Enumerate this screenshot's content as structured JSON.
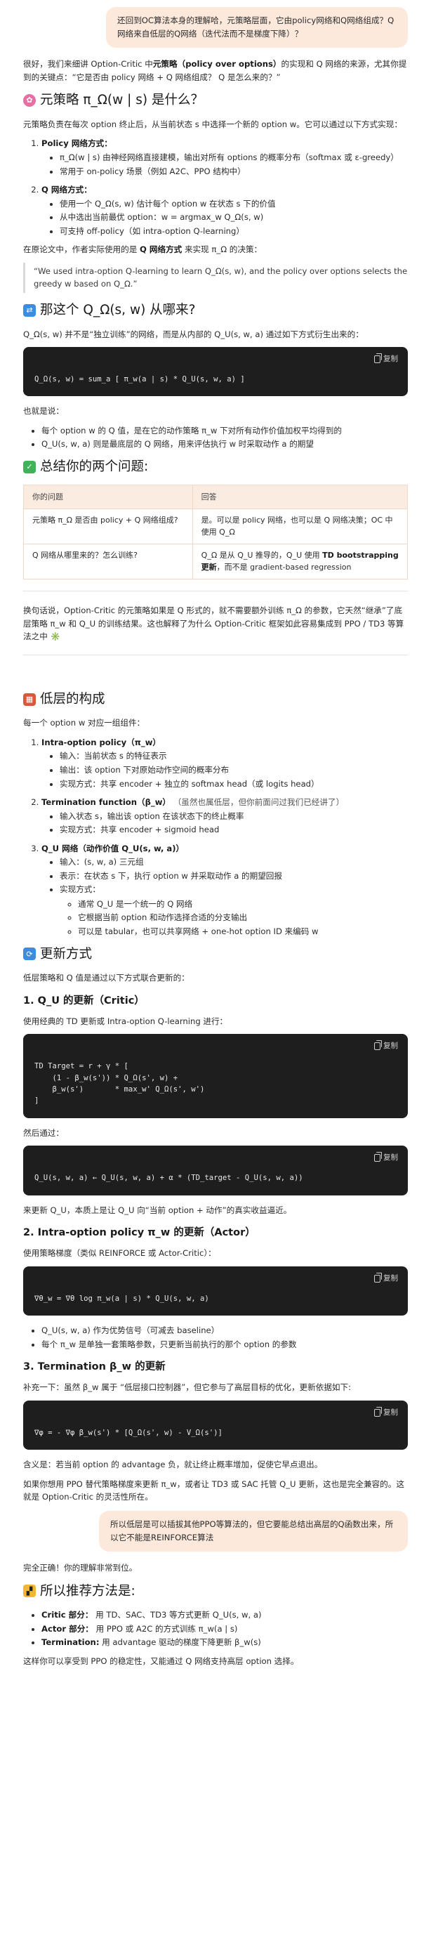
{
  "user_msg_1": "还回到OC算法本身的理解哈，元策略层面，它由policy网络和Q网络组成？Q网络来自低层的Q网络（迭代法而不是梯度下降）？",
  "intro": "很好，我们来细讲 Option-Critic 中元策略（policy over options）的实现和 Q 网络的来源，尤其你提到的关键点：“它是否由 policy 网络 + Q 网络组成？ Q 是怎么来的？”",
  "sec1": {
    "title": "元策略 π_Ω(w | s) 是什么？",
    "desc": "元策略负责在每次 option 终止后，从当前状态 s 中选择一个新的 option w。它可以通过以下方式实现：",
    "items": [
      {
        "title": "Policy 网络方式：",
        "bullets": [
          "π_Ω(w | s) 由神经网络直接建模，输出对所有 options 的概率分布（softmax 或 ε-greedy）",
          "常用于 on-policy 场景（例如 A2C、PPO 结构中）"
        ]
      },
      {
        "title": "Q 网络方式：",
        "bullets": [
          "使用一个 Q_Ω(s, w) 估计每个 option w 在状态 s 下的价值",
          "从中选出当前最优 option：w = argmax_w Q_Ω(s, w)",
          "可支持 off-policy（如 intra-option Q-learning）"
        ]
      }
    ],
    "paper_note": "在原论文中，作者实际使用的是 Q 网络方式 来实现 π_Ω 的决策：",
    "quote": "“We used intra-option Q-learning to learn Q_Ω(s, w), and the policy over options selects the greedy w based on Q_Ω.”"
  },
  "sec2": {
    "title": "那这个 Q_Ω(s, w) 从哪来?",
    "desc": "Q_Ω(s, w) 并不是“独立训练”的网络，而是从内部的 Q_U(s, w, a) 通过如下方式衍生出来的：",
    "code": "Q_Ω(s, w) = sum_a [ π_w(a | s) * Q_U(s, w, a) ]",
    "also": "也就是说：",
    "bullets": [
      "每个 option w 的 Q 值，是在它的动作策略 π_w 下对所有动作价值加权平均得到的",
      "Q_U(s, w, a) 则是最底层的 Q 网络，用来评估执行 w 时采取动作 a 的期望"
    ]
  },
  "sec3": {
    "title": "总结你的两个问题:",
    "headers": [
      "你的问题",
      "回答"
    ],
    "rows": [
      [
        "元策略 π_Ω 是否由 policy + Q 网络组成?",
        "是。可以是 policy 网络，也可以是 Q 网络决策；OC 中使用 Q_Ω"
      ],
      [
        "Q 网络从哪里来的？怎么训练?",
        "Q_Ω 是从 Q_U 推导的，Q_U 使用 TD bootstrapping 更新，而不是 gradient-based regression"
      ]
    ],
    "summary": "换句话说，Option-Critic 的元策略如果是 Q 形式的，就不需要额外训练 π_Ω 的参数，它天然“继承”了底层策略 π_w 和 Q_U 的训练结果。这也解释了为什么 Option-Critic 框架如此容易集成到 PPO / TD3 等算法之中 ✳️"
  },
  "sec4": {
    "title": "低层的构成",
    "desc": "每一个 option w 对应一组组件：",
    "items": [
      {
        "title": "Intra-option policy（π_w）",
        "extra": "",
        "bullets": [
          {
            "t": "输入：当前状态 s 的特征表示",
            "sub": []
          },
          {
            "t": "输出：该 option 下对原始动作空间的概率分布",
            "sub": []
          },
          {
            "t": "实现方式：共享 encoder + 独立的 softmax head（或 logits head）",
            "sub": []
          }
        ]
      },
      {
        "title": "Termination function（β_w）",
        "extra": "（虽然也属低层，但你前面问过我们已经讲了）",
        "bullets": [
          {
            "t": "输入状态 s，输出该 option 在该状态下的终止概率",
            "sub": []
          },
          {
            "t": "实现方式：共享 encoder + sigmoid head",
            "sub": []
          }
        ]
      },
      {
        "title": "Q_U 网络（动作价值 Q_U(s, w, a)）",
        "extra": "",
        "bullets": [
          {
            "t": "输入：(s, w, a) 三元组",
            "sub": []
          },
          {
            "t": "表示：在状态 s 下，执行 option w 并采取动作 a 的期望回报",
            "sub": []
          },
          {
            "t": "实现方式：",
            "sub": [
              "通常 Q_U 是一个统一的 Q 网络",
              "它根据当前 option 和动作选择合适的分支输出",
              "可以是 tabular，也可以共享网络 + one-hot option ID 来编码 w"
            ]
          }
        ]
      }
    ]
  },
  "sec5": {
    "title": "更新方式",
    "desc": "低层策略和 Q 值是通过以下方式联合更新的：",
    "h_critic": "1. Q_U 的更新（Critic）",
    "critic_desc": "使用经典的 TD 更新或 Intra-option Q-learning 进行：",
    "code1": "TD Target = r + γ * [\n    (1 - β_w(s')) * Q_Ω(s', w) +\n    β_w(s')       * max_w' Q_Ω(s', w')\n]",
    "then": "然后通过：",
    "code2": "Q_U(s, w, a) ← Q_U(s, w, a) + α * (TD_target - Q_U(s, w, a))",
    "after": "来更新 Q_U，本质上是让 Q_U 向“当前 option + 动作”的真实收益逼近。",
    "h_actor": "2. Intra-option policy π_w 的更新（Actor）",
    "actor_desc": "使用策略梯度（类似 REINFORCE 或 Actor-Critic）：",
    "code3": "∇θ_w = ∇θ log π_w(a | s) * Q_U(s, w, a)",
    "actor_bullets": [
      "Q_U(s, w, a) 作为优势信号（可减去 baseline）",
      "每个 π_w 是单独一套策略参数，只更新当前执行的那个 option 的参数"
    ],
    "h_term": "3. Termination β_w 的更新",
    "term_desc": "补充一下：虽然 β_w 属于 “低层接口控制器”，但它参与了高层目标的优化，更新依据如下:",
    "code4": "∇φ = - ∇φ β_w(s') * [Q_Ω(s', w) - V_Ω(s')]",
    "term_after": "含义是：若当前 option 的 advantage 负，就让终止概率增加，促使它早点退出。",
    "closing": "如果你想用 PPO 替代策略梯度来更新 π_w，或者让 TD3 或 SAC 托管 Q_U 更新，这也是完全兼容的。这就是 Option-Critic 的灵活性所在。"
  },
  "user_msg_2": "所以低层是可以插拔其他PPO等算法的，但它要能总结出高层的Q函数出来，所以它不能是REINFORCE算法",
  "reply2": {
    "intro": "完全正确！你的理解非常到位。",
    "title": "所以推荐方法是:",
    "items": [
      {
        "label": "Critic 部分：",
        "text": "用 TD、SAC、TD3 等方式更新 Q_U(s, w, a)"
      },
      {
        "label": "Actor 部分：",
        "text": "用 PPO 或 A2C 的方式训练 π_w(a | s)"
      },
      {
        "label": "Termination:",
        "text": "用 advantage 驱动的梯度下降更新 β_w(s)"
      }
    ],
    "closing": "这样你可以享受到 PPO 的稳定性，又能通过 Q 网络支持高层 option 选择。"
  },
  "copy_label": "复制",
  "colors": {
    "bubble": "#fce9dc",
    "code_bg": "#1e1e1e",
    "table_head": "#fbece1"
  }
}
